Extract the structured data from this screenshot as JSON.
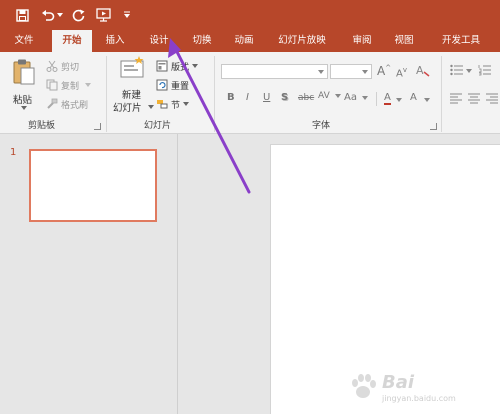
{
  "quick_access": {
    "save_icon": "save-icon",
    "undo_icon": "undo-icon",
    "redo_icon": "redo-icon",
    "present_icon": "start-from-beginning-icon",
    "customize_icon": "customize-toolbar-icon"
  },
  "tabs": [
    {
      "label": "文件",
      "active": false
    },
    {
      "label": "开始",
      "active": true
    },
    {
      "label": "插入",
      "active": false
    },
    {
      "label": "设计",
      "active": false
    },
    {
      "label": "切换",
      "active": false
    },
    {
      "label": "动画",
      "active": false
    },
    {
      "label": "幻灯片放映",
      "active": false
    },
    {
      "label": "审阅",
      "active": false
    },
    {
      "label": "视图",
      "active": false
    },
    {
      "label": "开发工具",
      "active": false
    }
  ],
  "ribbon": {
    "clipboard": {
      "paste_label": "粘贴",
      "cut_label": "剪切",
      "copy_label": "复制",
      "format_painter_label": "格式刷",
      "group_label": "剪贴板"
    },
    "slides": {
      "new_slide_line1": "新建",
      "new_slide_line2": "幻灯片",
      "layout_label": "版式",
      "reset_label": "重置",
      "section_label": "节",
      "group_label": "幻灯片"
    },
    "font": {
      "font_name_value": "",
      "font_size_value": "",
      "grow_label": "A",
      "shrink_label": "A",
      "bold_label": "B",
      "italic_label": "I",
      "underline_label": "U",
      "shadow_label": "S",
      "strike_label": "abc",
      "spacing_label": "AV",
      "case_label": "Aa",
      "color_label": "A",
      "group_label": "字体"
    }
  },
  "thumbnails": {
    "slide_number": "1"
  },
  "watermark": {
    "brand": "Bai",
    "sub": "jingyan.baidu.com"
  },
  "colors": {
    "accent": "#b7472a",
    "thumbnail_border": "#e07a5f",
    "annotation_arrow": "#8a3fc9"
  }
}
